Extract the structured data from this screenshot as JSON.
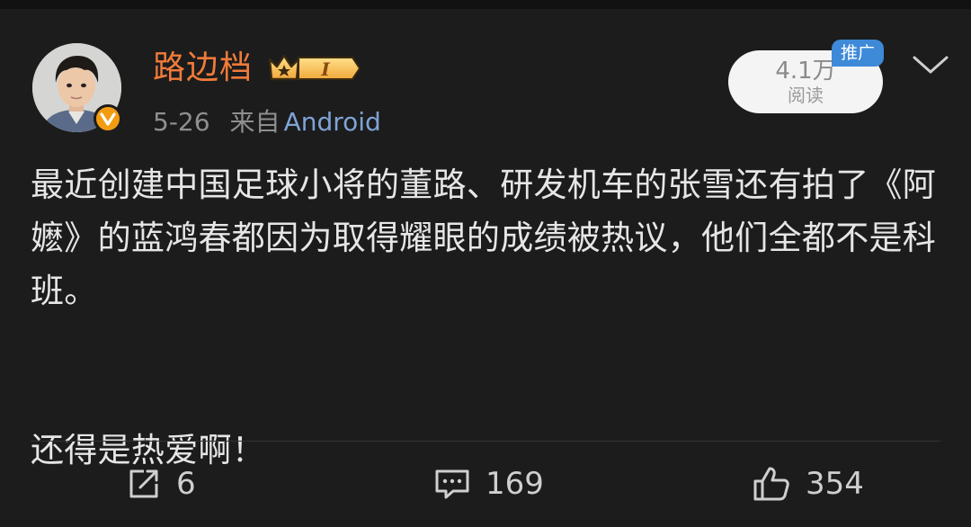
{
  "author": {
    "name": "路边档",
    "level_badge": "I"
  },
  "meta": {
    "date": "5-26",
    "source_prefix": "来自",
    "source": "Android"
  },
  "reads": {
    "count": "4.1万",
    "label": "阅读",
    "promo_tag": "推广"
  },
  "post": {
    "paragraphs": [
      "最近创建中国足球小将的董路、研发机车的张雪还有拍了《阿嬷》的蓝鸿春都因为取得耀眼的成绩被热议，他们全都不是科班。",
      "还得是热爱啊！"
    ]
  },
  "actions": {
    "reposts": "6",
    "comments": "169",
    "likes": "354"
  },
  "colors": {
    "background": "#1c1c1c",
    "username": "#f07b3a",
    "link": "#7fa3d6",
    "promo": "#3e8ad8",
    "verified": "#f39c12"
  },
  "icons": {
    "verified": "verified-v-icon",
    "badge": "crown-level-icon",
    "menu": "chevron-down-icon",
    "repost": "repost-icon",
    "comment": "comment-icon",
    "like": "thumbs-up-icon"
  }
}
